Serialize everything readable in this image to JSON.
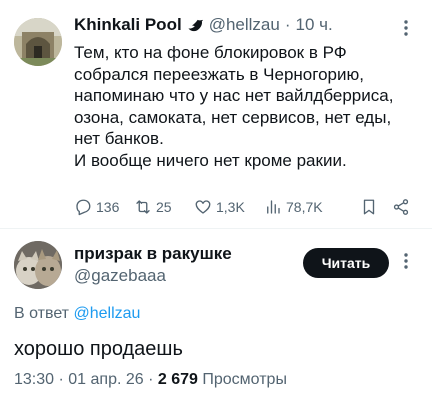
{
  "tweet": {
    "author_name": "Khinkali Pool",
    "handle": "@hellzau",
    "separator": "·",
    "time": "10 ч.",
    "text_lines": [
      "Тем, кто на фоне блокировок в РФ",
      "собрался переезжать в Черногорию,",
      "напоминаю что у нас нет вайлдберриса,",
      "озона, самоката, нет сервисов, нет еды,",
      "нет банков.",
      "И вообще ничего нет кроме ракии."
    ],
    "stats": {
      "replies": "136",
      "retweets": "25",
      "likes": "1,3K",
      "views": "78,7K"
    }
  },
  "reply": {
    "author_name": "призрак в ракушке",
    "handle": "@gazebaaa",
    "follow_label": "Читать",
    "reply_to_prefix": "В ответ",
    "reply_to_handle": "@hellzau",
    "text": "хорошо продаешь",
    "timestamp": "13:30 · 01 апр. 26 ·",
    "views_count": "2 679",
    "views_label": "Просмотры"
  },
  "colors": {
    "text": "#0f1419",
    "secondary": "#536471",
    "link": "#1d9bf0",
    "button": "#0f1419"
  }
}
